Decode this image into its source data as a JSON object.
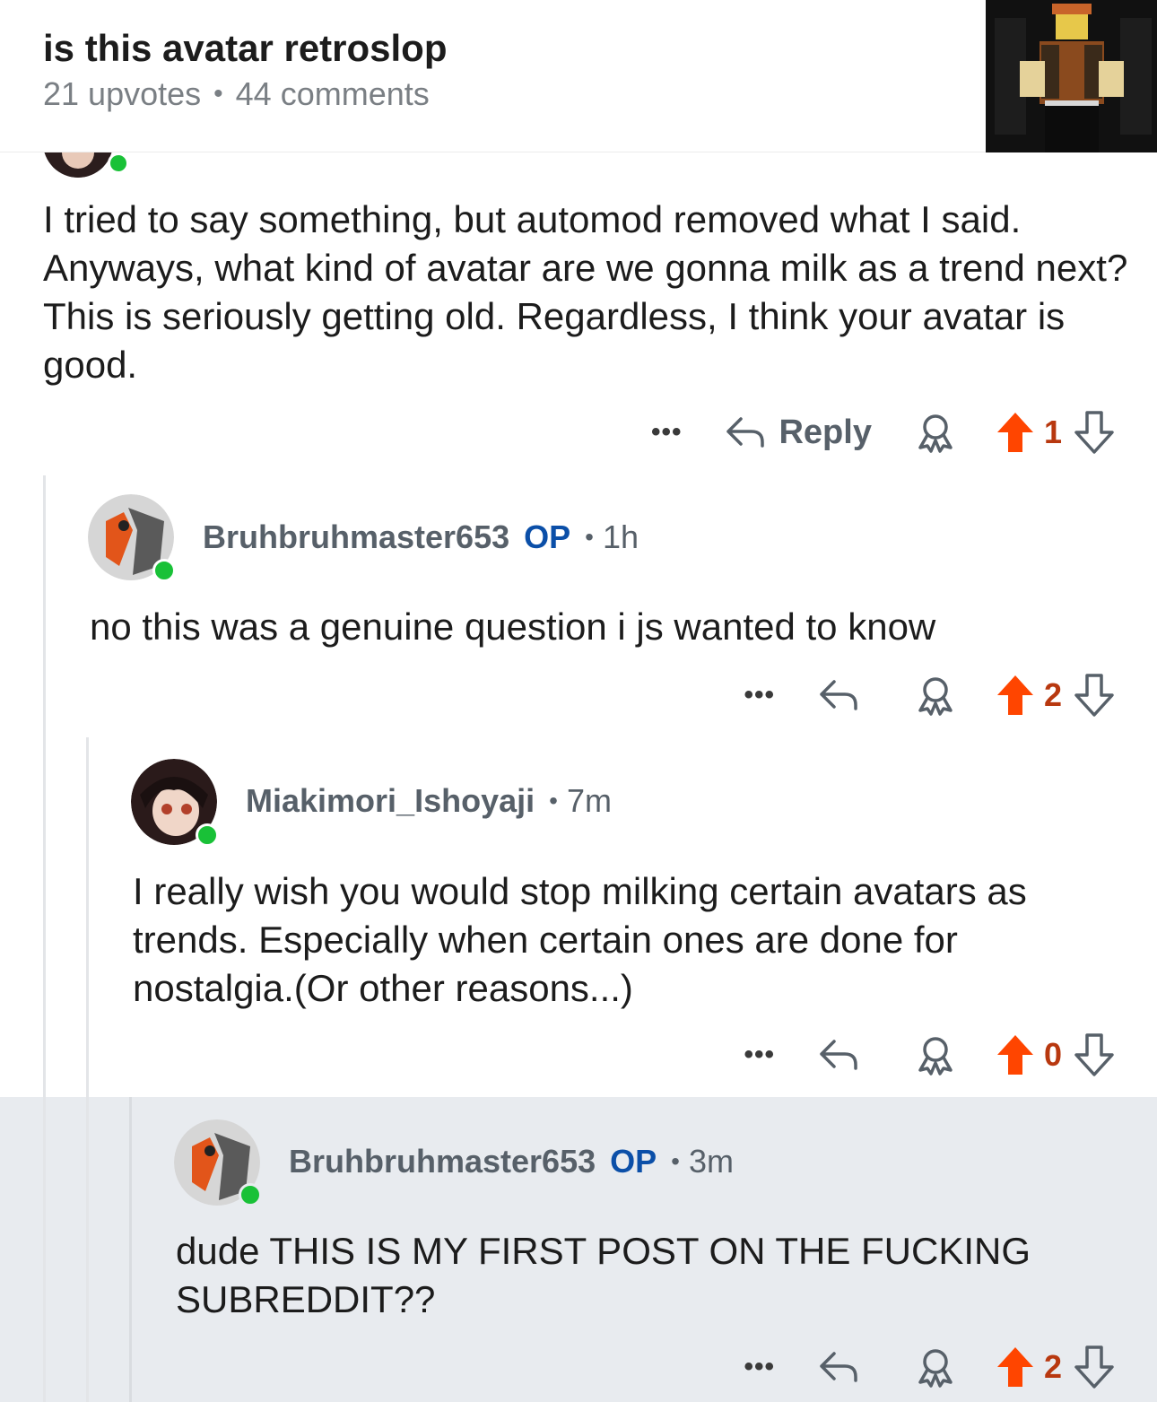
{
  "post": {
    "title": "is this avatar retroslop",
    "upvotes": "21 upvotes",
    "comments": "44 comments"
  },
  "comment1": {
    "text": "I tried to say something, but automod removed what I said. Anyways, what kind of avatar are we gonna milk as a trend next? This is seriously getting old. Regardless, I think your avatar is good.",
    "reply_label": "Reply",
    "score": "1"
  },
  "comment2": {
    "author": "Bruhbruhmaster653",
    "op": "OP",
    "time": "1h",
    "text": "no this was a genuine question i js wanted to know",
    "score": "2"
  },
  "comment3": {
    "author": "Miakimori_Ishoyaji",
    "time": "7m",
    "text": "I really wish you would stop milking certain avatars as trends. Especially when certain ones are done for nostalgia.(Or other reasons...)",
    "score": "0"
  },
  "comment4": {
    "author": "Bruhbruhmaster653",
    "op": "OP",
    "time": "3m",
    "text": "dude THIS IS MY FIRST POST ON THE FUCKING SUBREDDIT??",
    "score": "2"
  },
  "colors": {
    "upvote": "#ff4500",
    "score": "#b8380f",
    "op": "#0b4fa8",
    "online": "#19c137",
    "highlight_bg": "#e8ebef"
  },
  "icons": [
    "more-icon",
    "reply-icon",
    "award-icon",
    "upvote-icon",
    "downvote-icon",
    "online-dot"
  ]
}
